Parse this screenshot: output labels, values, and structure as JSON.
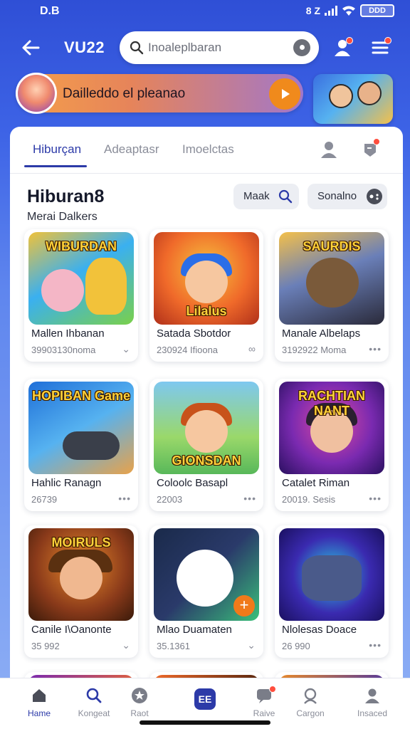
{
  "status_bar": {
    "time": "D.B",
    "right_text": "8 Z",
    "battery": "DDD"
  },
  "appbar": {
    "title": "VU22",
    "search_placeholder": "Inoaleplbaran"
  },
  "promo": {
    "text": "Dailleddo el pleanao"
  },
  "tabs": [
    {
      "label": "Hiburçan",
      "active": true
    },
    {
      "label": "Adeaptasr",
      "active": false
    },
    {
      "label": "Imoelctas",
      "active": false
    }
  ],
  "section": {
    "title": "Hiburan8",
    "subtitle": "Merai Dalkers",
    "chips": [
      {
        "label": "Maak"
      },
      {
        "label": "Sonalno"
      }
    ]
  },
  "cards": [
    {
      "art_title": "WIBURDAN",
      "name": "Mallen Ihbanan",
      "meta": "39903130noma",
      "more": "⌄",
      "palette": [
        "#3ab0f0",
        "#e9a93a"
      ]
    },
    {
      "art_title": "Lilalus",
      "name": "Satada Sbotdor",
      "meta": "230924 Ifioona",
      "more": "∞",
      "palette": [
        "#f06a2a",
        "#f6c23e"
      ]
    },
    {
      "art_title": "SAURDIS",
      "name": "Manale Albelaps",
      "meta": "3192922 Moma",
      "more": "•••",
      "palette": [
        "#5a6fa8",
        "#c98b3a"
      ]
    },
    {
      "art_title": "HOPIBAN Game",
      "name": "Hahlic Ranagn",
      "meta": "26739",
      "more": "•••",
      "palette": [
        "#1f6fd8",
        "#e8a24a"
      ]
    },
    {
      "art_title": "GIONSDAN",
      "name": "Coloolc Basapl",
      "meta": "22003",
      "more": "•••",
      "palette": [
        "#58b85a",
        "#7ec8f0"
      ]
    },
    {
      "art_title": "RACHTIAN NANT",
      "name": "Catalet Riman",
      "meta": "20019. Sesis",
      "more": "•••",
      "palette": [
        "#7a2ab0",
        "#e04aa0"
      ]
    },
    {
      "art_title": "MOIRULS",
      "name": "Canile I\\Oanonte",
      "meta": "35 992",
      "more": "⌄",
      "palette": [
        "#8a3a1a",
        "#e88a2a"
      ]
    },
    {
      "art_title": "",
      "name": "Mlao Duamaten",
      "meta": "35.1361",
      "more": "⌄",
      "palette": [
        "#1a2a4a",
        "#3ac07a"
      ]
    },
    {
      "art_title": "",
      "name": "Nlolesas Doace",
      "meta": "26 990",
      "more": "•••",
      "palette": [
        "#3a2ab0",
        "#2ad0e0"
      ]
    }
  ],
  "bottom_nav": [
    {
      "label": "Hame",
      "icon": "home-icon",
      "active": true
    },
    {
      "label": "Kongeat",
      "icon": "search-icon",
      "active": false
    },
    {
      "label": "Raot",
      "icon": "star-icon",
      "active": false
    },
    {
      "label": "",
      "icon": "apps-icon",
      "center_text": "EE",
      "active": false
    },
    {
      "label": "Raive",
      "icon": "chat-icon",
      "active": false
    },
    {
      "label": "Cargon",
      "icon": "account-icon",
      "active": false
    },
    {
      "label": "Insaced",
      "icon": "profile-icon",
      "active": false
    }
  ],
  "colors": {
    "accent": "#2c3aa8",
    "header_bg": "#2f4fd6",
    "orange": "#f08a1c",
    "badge": "#ff4e3e"
  }
}
